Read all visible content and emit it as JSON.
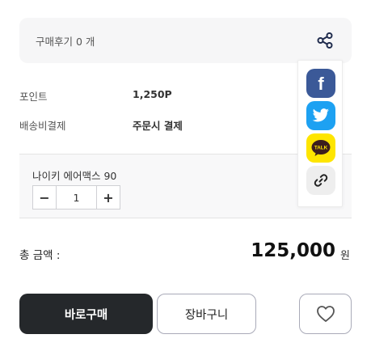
{
  "review": {
    "label": "구매후기 0 개"
  },
  "info": [
    {
      "label": "포인트",
      "value": "1,250P"
    },
    {
      "label": "배송비결제",
      "value": "주문시 결제"
    }
  ],
  "option": {
    "name": "나이키 에어맥스 90",
    "quantity": "1",
    "minus": "−",
    "plus": "+"
  },
  "total": {
    "label": "총 금액 :",
    "amount": "125,000",
    "unit": "원"
  },
  "buttons": {
    "buy": "바로구매",
    "cart": "장바구니"
  },
  "share": {
    "icons": [
      "share-icon",
      "facebook-icon",
      "twitter-icon",
      "kakaotalk-icon",
      "link-icon",
      "heart-icon"
    ],
    "facebook_letter": "f",
    "kakao_text": "TALK",
    "colors": {
      "facebook": "#3b5998",
      "twitter": "#1da1f2",
      "kakao": "#fee500",
      "link_bg": "#eeeeee"
    }
  },
  "colors": {
    "buy_button": "#25282b",
    "review_bar": "#f6f6f7",
    "border": "#a9aab8"
  }
}
